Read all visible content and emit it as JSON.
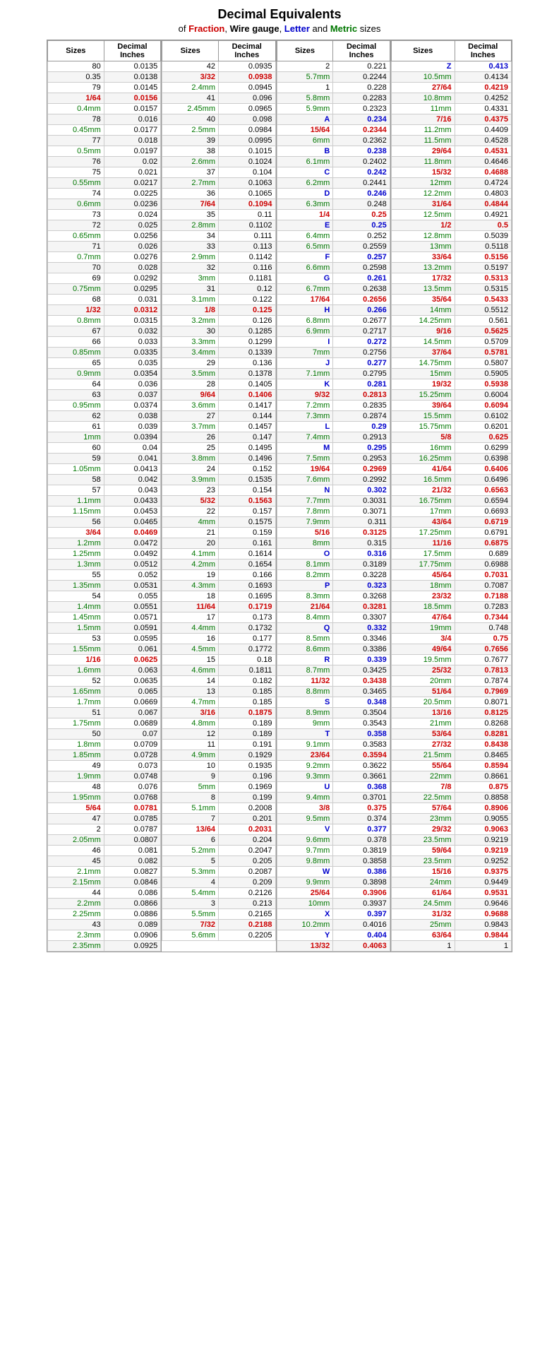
{
  "title": "Decimal Equivalents",
  "subtitle": {
    "prefix": "of ",
    "fraction": "Fraction",
    "sep1": ", ",
    "wire": "Wire gauge",
    "sep2": ", ",
    "letter": "Letter",
    "sep3": " and ",
    "metric": "Metric",
    "suffix": " sizes"
  },
  "col1_header": [
    "Sizes",
    "Decimal\nInches"
  ],
  "col2_header": [
    "Sizes",
    "Decimal\nInches"
  ],
  "col3_header": [
    "Sizes",
    "Decimal\nInches"
  ],
  "col4_header": [
    "Sizes",
    "Decimal\nInches"
  ],
  "col1": [
    [
      "80",
      "0.0135"
    ],
    [
      "0.35",
      "0.0138"
    ],
    [
      "79",
      "0.0145"
    ],
    [
      "1/64",
      "0.0156"
    ],
    [
      "0.4mm",
      "0.0157"
    ],
    [
      "78",
      "0.016"
    ],
    [
      "0.45mm",
      "0.0177"
    ],
    [
      "77",
      "0.018"
    ],
    [
      "0.5mm",
      "0.0197"
    ],
    [
      "76",
      "0.02"
    ],
    [
      "75",
      "0.021"
    ],
    [
      "0.55mm",
      "0.0217"
    ],
    [
      "74",
      "0.0225"
    ],
    [
      "0.6mm",
      "0.0236"
    ],
    [
      "73",
      "0.024"
    ],
    [
      "72",
      "0.025"
    ],
    [
      "0.65mm",
      "0.0256"
    ],
    [
      "71",
      "0.026"
    ],
    [
      "0.7mm",
      "0.0276"
    ],
    [
      "70",
      "0.028"
    ],
    [
      "69",
      "0.0292"
    ],
    [
      "0.75mm",
      "0.0295"
    ],
    [
      "68",
      "0.031"
    ],
    [
      "1/32",
      "0.0312"
    ],
    [
      "0.8mm",
      "0.0315"
    ],
    [
      "67",
      "0.032"
    ],
    [
      "66",
      "0.033"
    ],
    [
      "0.85mm",
      "0.0335"
    ],
    [
      "65",
      "0.035"
    ],
    [
      "0.9mm",
      "0.0354"
    ],
    [
      "64",
      "0.036"
    ],
    [
      "63",
      "0.037"
    ],
    [
      "0.95mm",
      "0.0374"
    ],
    [
      "62",
      "0.038"
    ],
    [
      "61",
      "0.039"
    ],
    [
      "1mm",
      "0.0394"
    ],
    [
      "60",
      "0.04"
    ],
    [
      "59",
      "0.041"
    ],
    [
      "1.05mm",
      "0.0413"
    ],
    [
      "58",
      "0.042"
    ],
    [
      "57",
      "0.043"
    ],
    [
      "1.1mm",
      "0.0433"
    ],
    [
      "1.15mm",
      "0.0453"
    ],
    [
      "56",
      "0.0465"
    ],
    [
      "3/64",
      "0.0469"
    ],
    [
      "1.2mm",
      "0.0472"
    ],
    [
      "1.25mm",
      "0.0492"
    ],
    [
      "1.3mm",
      "0.0512"
    ],
    [
      "55",
      "0.052"
    ],
    [
      "1.35mm",
      "0.0531"
    ],
    [
      "54",
      "0.055"
    ],
    [
      "1.4mm",
      "0.0551"
    ],
    [
      "1.45mm",
      "0.0571"
    ],
    [
      "1.5mm",
      "0.0591"
    ],
    [
      "53",
      "0.0595"
    ],
    [
      "1.55mm",
      "0.061"
    ],
    [
      "1/16",
      "0.0625"
    ],
    [
      "1.6mm",
      "0.063"
    ],
    [
      "52",
      "0.0635"
    ],
    [
      "1.65mm",
      "0.065"
    ],
    [
      "1.7mm",
      "0.0669"
    ],
    [
      "51",
      "0.067"
    ],
    [
      "1.75mm",
      "0.0689"
    ],
    [
      "50",
      "0.07"
    ],
    [
      "1.8mm",
      "0.0709"
    ],
    [
      "1.85mm",
      "0.0728"
    ],
    [
      "49",
      "0.073"
    ],
    [
      "1.9mm",
      "0.0748"
    ],
    [
      "48",
      "0.076"
    ],
    [
      "1.95mm",
      "0.0768"
    ],
    [
      "5/64",
      "0.0781"
    ],
    [
      "47",
      "0.0785"
    ],
    [
      "2",
      "0.0787"
    ],
    [
      "2.05mm",
      "0.0807"
    ],
    [
      "46",
      "0.081"
    ],
    [
      "45",
      "0.082"
    ],
    [
      "2.1mm",
      "0.0827"
    ],
    [
      "2.15mm",
      "0.0846"
    ],
    [
      "44",
      "0.086"
    ],
    [
      "2.2mm",
      "0.0866"
    ],
    [
      "2.25mm",
      "0.0886"
    ],
    [
      "43",
      "0.089"
    ],
    [
      "2.3mm",
      "0.0906"
    ],
    [
      "2.35mm",
      "0.0925"
    ]
  ],
  "col2": [
    [
      "42",
      "0.0935"
    ],
    [
      "3/32",
      "0.0938"
    ],
    [
      "2.4mm",
      "0.0945"
    ],
    [
      "41",
      "0.096"
    ],
    [
      "2.45mm",
      "0.0965"
    ],
    [
      "40",
      "0.098"
    ],
    [
      "2.5mm",
      "0.0984"
    ],
    [
      "39",
      "0.0995"
    ],
    [
      "38",
      "0.1015"
    ],
    [
      "2.6mm",
      "0.1024"
    ],
    [
      "37",
      "0.104"
    ],
    [
      "2.7mm",
      "0.1063"
    ],
    [
      "36",
      "0.1065"
    ],
    [
      "7/64",
      "0.1094"
    ],
    [
      "35",
      "0.11"
    ],
    [
      "2.8mm",
      "0.1102"
    ],
    [
      "34",
      "0.111"
    ],
    [
      "33",
      "0.113"
    ],
    [
      "2.9mm",
      "0.1142"
    ],
    [
      "32",
      "0.116"
    ],
    [
      "3mm",
      "0.1181"
    ],
    [
      "31",
      "0.12"
    ],
    [
      "3.1mm",
      "0.122"
    ],
    [
      "1/8",
      "0.125"
    ],
    [
      "3.2mm",
      "0.126"
    ],
    [
      "30",
      "0.1285"
    ],
    [
      "3.3mm",
      "0.1299"
    ],
    [
      "3.4mm",
      "0.1339"
    ],
    [
      "29",
      "0.136"
    ],
    [
      "3.5mm",
      "0.1378"
    ],
    [
      "28",
      "0.1405"
    ],
    [
      "9/64",
      "0.1406"
    ],
    [
      "3.6mm",
      "0.1417"
    ],
    [
      "27",
      "0.144"
    ],
    [
      "3.7mm",
      "0.1457"
    ],
    [
      "26",
      "0.147"
    ],
    [
      "25",
      "0.1495"
    ],
    [
      "3.8mm",
      "0.1496"
    ],
    [
      "24",
      "0.152"
    ],
    [
      "3.9mm",
      "0.1535"
    ],
    [
      "23",
      "0.154"
    ],
    [
      "5/32",
      "0.1563"
    ],
    [
      "22",
      "0.157"
    ],
    [
      "4mm",
      "0.1575"
    ],
    [
      "21",
      "0.159"
    ],
    [
      "20",
      "0.161"
    ],
    [
      "4.1mm",
      "0.1614"
    ],
    [
      "4.2mm",
      "0.1654"
    ],
    [
      "19",
      "0.166"
    ],
    [
      "4.3mm",
      "0.1693"
    ],
    [
      "18",
      "0.1695"
    ],
    [
      "11/64",
      "0.1719"
    ],
    [
      "17",
      "0.173"
    ],
    [
      "4.4mm",
      "0.1732"
    ],
    [
      "16",
      "0.177"
    ],
    [
      "4.5mm",
      "0.1772"
    ],
    [
      "15",
      "0.18"
    ],
    [
      "4.6mm",
      "0.1811"
    ],
    [
      "14",
      "0.182"
    ],
    [
      "13",
      "0.185"
    ],
    [
      "4.7mm",
      "0.185"
    ],
    [
      "3/16",
      "0.1875"
    ],
    [
      "4.8mm",
      "0.189"
    ],
    [
      "12",
      "0.189"
    ],
    [
      "11",
      "0.191"
    ],
    [
      "4.9mm",
      "0.1929"
    ],
    [
      "10",
      "0.1935"
    ],
    [
      "9",
      "0.196"
    ],
    [
      "5mm",
      "0.1969"
    ],
    [
      "8",
      "0.199"
    ],
    [
      "5.1mm",
      "0.2008"
    ],
    [
      "7",
      "0.201"
    ],
    [
      "13/64",
      "0.2031"
    ],
    [
      "6",
      "0.204"
    ],
    [
      "5.2mm",
      "0.2047"
    ],
    [
      "5",
      "0.205"
    ],
    [
      "5.3mm",
      "0.2087"
    ],
    [
      "4",
      "0.209"
    ],
    [
      "5.4mm",
      "0.2126"
    ],
    [
      "3",
      "0.213"
    ],
    [
      "5.5mm",
      "0.2165"
    ],
    [
      "7/32",
      "0.2188"
    ],
    [
      "5.6mm",
      "0.2205"
    ]
  ],
  "col3": [
    [
      "2",
      "0.221"
    ],
    [
      "5.7mm",
      "0.2244"
    ],
    [
      "1",
      "0.228"
    ],
    [
      "5.8mm",
      "0.2283"
    ],
    [
      "5.9mm",
      "0.2323"
    ],
    [
      "A",
      "0.234"
    ],
    [
      "15/64",
      "0.2344"
    ],
    [
      "6mm",
      "0.2362"
    ],
    [
      "B",
      "0.238"
    ],
    [
      "6.1mm",
      "0.2402"
    ],
    [
      "C",
      "0.242"
    ],
    [
      "6.2mm",
      "0.2441"
    ],
    [
      "D",
      "0.246"
    ],
    [
      "6.3mm",
      "0.248"
    ],
    [
      "1/4",
      "0.25"
    ],
    [
      "E",
      "0.25"
    ],
    [
      "6.4mm",
      "0.252"
    ],
    [
      "6.5mm",
      "0.2559"
    ],
    [
      "F",
      "0.257"
    ],
    [
      "6.6mm",
      "0.2598"
    ],
    [
      "G",
      "0.261"
    ],
    [
      "6.7mm",
      "0.2638"
    ],
    [
      "17/64",
      "0.2656"
    ],
    [
      "H",
      "0.266"
    ],
    [
      "6.8mm",
      "0.2677"
    ],
    [
      "6.9mm",
      "0.2717"
    ],
    [
      "I",
      "0.272"
    ],
    [
      "7mm",
      "0.2756"
    ],
    [
      "J",
      "0.277"
    ],
    [
      "7.1mm",
      "0.2795"
    ],
    [
      "K",
      "0.281"
    ],
    [
      "9/32",
      "0.2813"
    ],
    [
      "7.2mm",
      "0.2835"
    ],
    [
      "7.3mm",
      "0.2874"
    ],
    [
      "L",
      "0.29"
    ],
    [
      "7.4mm",
      "0.2913"
    ],
    [
      "M",
      "0.295"
    ],
    [
      "7.5mm",
      "0.2953"
    ],
    [
      "19/64",
      "0.2969"
    ],
    [
      "7.6mm",
      "0.2992"
    ],
    [
      "N",
      "0.302"
    ],
    [
      "7.7mm",
      "0.3031"
    ],
    [
      "7.8mm",
      "0.3071"
    ],
    [
      "7.9mm",
      "0.311"
    ],
    [
      "5/16",
      "0.3125"
    ],
    [
      "8mm",
      "0.315"
    ],
    [
      "O",
      "0.316"
    ],
    [
      "8.1mm",
      "0.3189"
    ],
    [
      "8.2mm",
      "0.3228"
    ],
    [
      "P",
      "0.323"
    ],
    [
      "8.3mm",
      "0.3268"
    ],
    [
      "21/64",
      "0.3281"
    ],
    [
      "8.4mm",
      "0.3307"
    ],
    [
      "Q",
      "0.332"
    ],
    [
      "8.5mm",
      "0.3346"
    ],
    [
      "8.6mm",
      "0.3386"
    ],
    [
      "R",
      "0.339"
    ],
    [
      "8.7mm",
      "0.3425"
    ],
    [
      "11/32",
      "0.3438"
    ],
    [
      "8.8mm",
      "0.3465"
    ],
    [
      "S",
      "0.348"
    ],
    [
      "8.9mm",
      "0.3504"
    ],
    [
      "9mm",
      "0.3543"
    ],
    [
      "T",
      "0.358"
    ],
    [
      "9.1mm",
      "0.3583"
    ],
    [
      "23/64",
      "0.3594"
    ],
    [
      "9.2mm",
      "0.3622"
    ],
    [
      "9.3mm",
      "0.3661"
    ],
    [
      "U",
      "0.368"
    ],
    [
      "9.4mm",
      "0.3701"
    ],
    [
      "3/8",
      "0.375"
    ],
    [
      "9.5mm",
      "0.374"
    ],
    [
      "V",
      "0.377"
    ],
    [
      "9.6mm",
      "0.378"
    ],
    [
      "9.7mm",
      "0.3819"
    ],
    [
      "9.8mm",
      "0.3858"
    ],
    [
      "W",
      "0.386"
    ],
    [
      "9.9mm",
      "0.3898"
    ],
    [
      "25/64",
      "0.3906"
    ],
    [
      "10mm",
      "0.3937"
    ],
    [
      "X",
      "0.397"
    ],
    [
      "10.2mm",
      "0.4016"
    ],
    [
      "Y",
      "0.404"
    ],
    [
      "13/32",
      "0.4063"
    ]
  ],
  "col4": [
    [
      "Z",
      "0.413"
    ],
    [
      "10.5mm",
      "0.4134"
    ],
    [
      "27/64",
      "0.4219"
    ],
    [
      "10.8mm",
      "0.4252"
    ],
    [
      "11mm",
      "0.4331"
    ],
    [
      "7/16",
      "0.4375"
    ],
    [
      "11.2mm",
      "0.4409"
    ],
    [
      "11.5mm",
      "0.4528"
    ],
    [
      "29/64",
      "0.4531"
    ],
    [
      "11.8mm",
      "0.4646"
    ],
    [
      "15/32",
      "0.4688"
    ],
    [
      "12mm",
      "0.4724"
    ],
    [
      "12.2mm",
      "0.4803"
    ],
    [
      "31/64",
      "0.4844"
    ],
    [
      "12.5mm",
      "0.4921"
    ],
    [
      "1/2",
      "0.5"
    ],
    [
      "12.8mm",
      "0.5039"
    ],
    [
      "13mm",
      "0.5118"
    ],
    [
      "33/64",
      "0.5156"
    ],
    [
      "13.2mm",
      "0.5197"
    ],
    [
      "17/32",
      "0.5313"
    ],
    [
      "13.5mm",
      "0.5315"
    ],
    [
      "35/64",
      "0.5433"
    ],
    [
      "14mm",
      "0.5512"
    ],
    [
      "14.25mm",
      "0.561"
    ],
    [
      "9/16",
      "0.5625"
    ],
    [
      "14.5mm",
      "0.5709"
    ],
    [
      "37/64",
      "0.5781"
    ],
    [
      "14.75mm",
      "0.5807"
    ],
    [
      "15mm",
      "0.5905"
    ],
    [
      "19/32",
      "0.5938"
    ],
    [
      "15.25mm",
      "0.6004"
    ],
    [
      "39/64",
      "0.6094"
    ],
    [
      "15.5mm",
      "0.6102"
    ],
    [
      "15.75mm",
      "0.6201"
    ],
    [
      "5/8",
      "0.625"
    ],
    [
      "16mm",
      "0.6299"
    ],
    [
      "16.25mm",
      "0.6398"
    ],
    [
      "41/64",
      "0.6406"
    ],
    [
      "16.5mm",
      "0.6496"
    ],
    [
      "21/32",
      "0.6563"
    ],
    [
      "16.75mm",
      "0.6594"
    ],
    [
      "17mm",
      "0.6693"
    ],
    [
      "43/64",
      "0.6719"
    ],
    [
      "17.25mm",
      "0.6791"
    ],
    [
      "11/16",
      "0.6875"
    ],
    [
      "17.5mm",
      "0.689"
    ],
    [
      "17.75mm",
      "0.6988"
    ],
    [
      "45/64",
      "0.7031"
    ],
    [
      "18mm",
      "0.7087"
    ],
    [
      "23/32",
      "0.7188"
    ],
    [
      "18.5mm",
      "0.7283"
    ],
    [
      "47/64",
      "0.7344"
    ],
    [
      "19mm",
      "0.748"
    ],
    [
      "3/4",
      "0.75"
    ],
    [
      "49/64",
      "0.7656"
    ],
    [
      "19.5mm",
      "0.7677"
    ],
    [
      "25/32",
      "0.7813"
    ],
    [
      "20mm",
      "0.7874"
    ],
    [
      "51/64",
      "0.7969"
    ],
    [
      "20.5mm",
      "0.8071"
    ],
    [
      "13/16",
      "0.8125"
    ],
    [
      "21mm",
      "0.8268"
    ],
    [
      "53/64",
      "0.8281"
    ],
    [
      "27/32",
      "0.8438"
    ],
    [
      "21.5mm",
      "0.8465"
    ],
    [
      "55/64",
      "0.8594"
    ],
    [
      "22mm",
      "0.8661"
    ],
    [
      "7/8",
      "0.875"
    ],
    [
      "22.5mm",
      "0.8858"
    ],
    [
      "57/64",
      "0.8906"
    ],
    [
      "23mm",
      "0.9055"
    ],
    [
      "29/32",
      "0.9063"
    ],
    [
      "23.5mm",
      "0.9219"
    ],
    [
      "59/64",
      "0.9219"
    ],
    [
      "23.5mm",
      "0.9252"
    ],
    [
      "15/16",
      "0.9375"
    ],
    [
      "24mm",
      "0.9449"
    ],
    [
      "61/64",
      "0.9531"
    ],
    [
      "24.5mm",
      "0.9646"
    ],
    [
      "31/32",
      "0.9688"
    ],
    [
      "25mm",
      "0.9843"
    ],
    [
      "63/64",
      "0.9844"
    ],
    [
      "1",
      "1"
    ]
  ]
}
